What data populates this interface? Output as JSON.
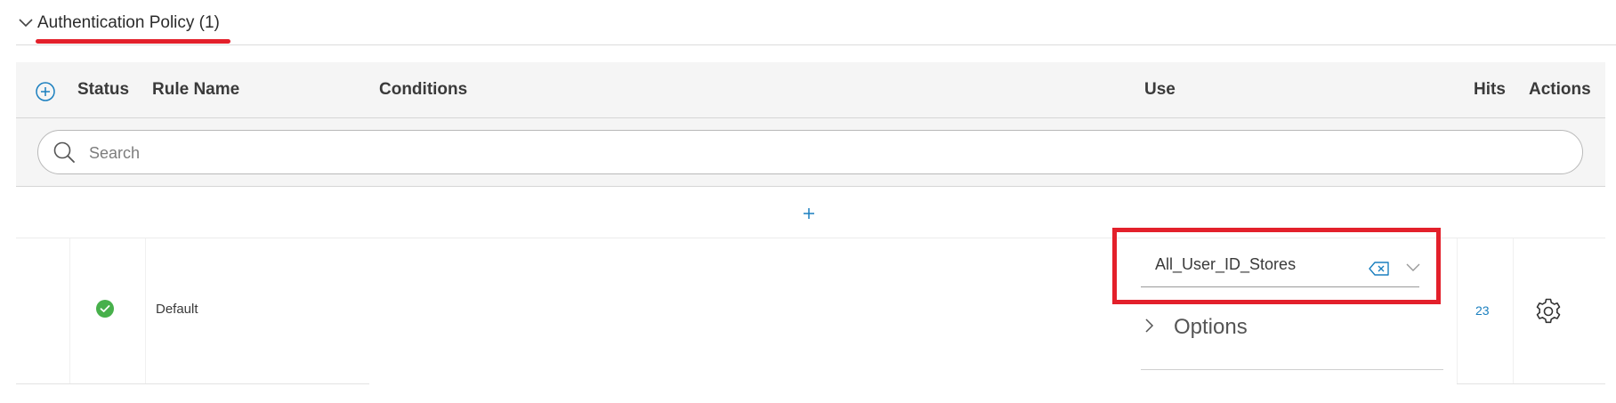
{
  "section": {
    "title": "Authentication Policy (1)",
    "chevron_icon": "chevron-down-icon"
  },
  "table": {
    "headers": {
      "add_icon": "plus-circle-icon",
      "status": "Status",
      "rule_name": "Rule Name",
      "conditions": "Conditions",
      "use": "Use",
      "hits": "Hits",
      "actions": "Actions"
    },
    "search": {
      "placeholder": "Search",
      "icon": "search-icon"
    },
    "insert_icon": "plus-icon",
    "rows": [
      {
        "status_icon": "check-circle-icon",
        "rule_name": "Default",
        "conditions": "",
        "use": {
          "value": "All_User_ID_Stores",
          "clear_icon": "clear-backspace-icon",
          "dropdown_icon": "chevron-down-icon",
          "options_label": "Options",
          "options_icon": "chevron-right-icon"
        },
        "hits": "23",
        "actions_icon": "gear-icon"
      }
    ]
  },
  "colors": {
    "highlight": "#e3202b",
    "accent": "#1a7fbf",
    "status_ok": "#47b04b",
    "header_bg": "#f5f5f5"
  }
}
